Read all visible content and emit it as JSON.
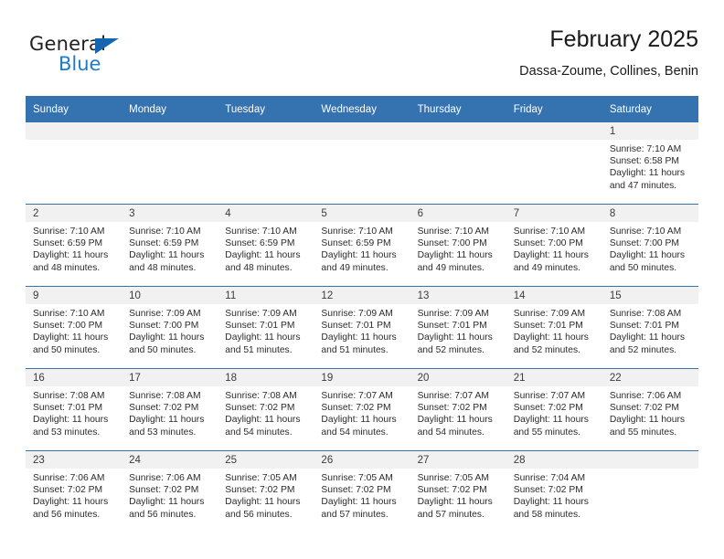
{
  "brand": {
    "name_part1": "General",
    "name_part2": "Blue",
    "triangle_color": "#1565b0",
    "blue_color": "#1f7bc7"
  },
  "header": {
    "title": "February 2025",
    "subtitle": "Dassa-Zoume, Collines, Benin"
  },
  "theme": {
    "header_blue": "#3572b0",
    "daynum_band": "#f1f1f1",
    "cell_background": "#ffffff",
    "text": "#222222"
  },
  "weekday_headers": [
    "Sunday",
    "Monday",
    "Tuesday",
    "Wednesday",
    "Thursday",
    "Friday",
    "Saturday"
  ],
  "weeks": [
    [
      {
        "day": "",
        "sunrise": "",
        "sunset": "",
        "daylight": "",
        "empty": true
      },
      {
        "day": "",
        "sunrise": "",
        "sunset": "",
        "daylight": "",
        "empty": true
      },
      {
        "day": "",
        "sunrise": "",
        "sunset": "",
        "daylight": "",
        "empty": true
      },
      {
        "day": "",
        "sunrise": "",
        "sunset": "",
        "daylight": "",
        "empty": true
      },
      {
        "day": "",
        "sunrise": "",
        "sunset": "",
        "daylight": "",
        "empty": true
      },
      {
        "day": "",
        "sunrise": "",
        "sunset": "",
        "daylight": "",
        "empty": true
      },
      {
        "day": "1",
        "sunrise": "Sunrise: 7:10 AM",
        "sunset": "Sunset: 6:58 PM",
        "daylight": "Daylight: 11 hours and 47 minutes."
      }
    ],
    [
      {
        "day": "2",
        "sunrise": "Sunrise: 7:10 AM",
        "sunset": "Sunset: 6:59 PM",
        "daylight": "Daylight: 11 hours and 48 minutes."
      },
      {
        "day": "3",
        "sunrise": "Sunrise: 7:10 AM",
        "sunset": "Sunset: 6:59 PM",
        "daylight": "Daylight: 11 hours and 48 minutes."
      },
      {
        "day": "4",
        "sunrise": "Sunrise: 7:10 AM",
        "sunset": "Sunset: 6:59 PM",
        "daylight": "Daylight: 11 hours and 48 minutes."
      },
      {
        "day": "5",
        "sunrise": "Sunrise: 7:10 AM",
        "sunset": "Sunset: 6:59 PM",
        "daylight": "Daylight: 11 hours and 49 minutes."
      },
      {
        "day": "6",
        "sunrise": "Sunrise: 7:10 AM",
        "sunset": "Sunset: 7:00 PM",
        "daylight": "Daylight: 11 hours and 49 minutes."
      },
      {
        "day": "7",
        "sunrise": "Sunrise: 7:10 AM",
        "sunset": "Sunset: 7:00 PM",
        "daylight": "Daylight: 11 hours and 49 minutes."
      },
      {
        "day": "8",
        "sunrise": "Sunrise: 7:10 AM",
        "sunset": "Sunset: 7:00 PM",
        "daylight": "Daylight: 11 hours and 50 minutes."
      }
    ],
    [
      {
        "day": "9",
        "sunrise": "Sunrise: 7:10 AM",
        "sunset": "Sunset: 7:00 PM",
        "daylight": "Daylight: 11 hours and 50 minutes."
      },
      {
        "day": "10",
        "sunrise": "Sunrise: 7:09 AM",
        "sunset": "Sunset: 7:00 PM",
        "daylight": "Daylight: 11 hours and 50 minutes."
      },
      {
        "day": "11",
        "sunrise": "Sunrise: 7:09 AM",
        "sunset": "Sunset: 7:01 PM",
        "daylight": "Daylight: 11 hours and 51 minutes."
      },
      {
        "day": "12",
        "sunrise": "Sunrise: 7:09 AM",
        "sunset": "Sunset: 7:01 PM",
        "daylight": "Daylight: 11 hours and 51 minutes."
      },
      {
        "day": "13",
        "sunrise": "Sunrise: 7:09 AM",
        "sunset": "Sunset: 7:01 PM",
        "daylight": "Daylight: 11 hours and 52 minutes."
      },
      {
        "day": "14",
        "sunrise": "Sunrise: 7:09 AM",
        "sunset": "Sunset: 7:01 PM",
        "daylight": "Daylight: 11 hours and 52 minutes."
      },
      {
        "day": "15",
        "sunrise": "Sunrise: 7:08 AM",
        "sunset": "Sunset: 7:01 PM",
        "daylight": "Daylight: 11 hours and 52 minutes."
      }
    ],
    [
      {
        "day": "16",
        "sunrise": "Sunrise: 7:08 AM",
        "sunset": "Sunset: 7:01 PM",
        "daylight": "Daylight: 11 hours and 53 minutes."
      },
      {
        "day": "17",
        "sunrise": "Sunrise: 7:08 AM",
        "sunset": "Sunset: 7:02 PM",
        "daylight": "Daylight: 11 hours and 53 minutes."
      },
      {
        "day": "18",
        "sunrise": "Sunrise: 7:08 AM",
        "sunset": "Sunset: 7:02 PM",
        "daylight": "Daylight: 11 hours and 54 minutes."
      },
      {
        "day": "19",
        "sunrise": "Sunrise: 7:07 AM",
        "sunset": "Sunset: 7:02 PM",
        "daylight": "Daylight: 11 hours and 54 minutes."
      },
      {
        "day": "20",
        "sunrise": "Sunrise: 7:07 AM",
        "sunset": "Sunset: 7:02 PM",
        "daylight": "Daylight: 11 hours and 54 minutes."
      },
      {
        "day": "21",
        "sunrise": "Sunrise: 7:07 AM",
        "sunset": "Sunset: 7:02 PM",
        "daylight": "Daylight: 11 hours and 55 minutes."
      },
      {
        "day": "22",
        "sunrise": "Sunrise: 7:06 AM",
        "sunset": "Sunset: 7:02 PM",
        "daylight": "Daylight: 11 hours and 55 minutes."
      }
    ],
    [
      {
        "day": "23",
        "sunrise": "Sunrise: 7:06 AM",
        "sunset": "Sunset: 7:02 PM",
        "daylight": "Daylight: 11 hours and 56 minutes."
      },
      {
        "day": "24",
        "sunrise": "Sunrise: 7:06 AM",
        "sunset": "Sunset: 7:02 PM",
        "daylight": "Daylight: 11 hours and 56 minutes."
      },
      {
        "day": "25",
        "sunrise": "Sunrise: 7:05 AM",
        "sunset": "Sunset: 7:02 PM",
        "daylight": "Daylight: 11 hours and 56 minutes."
      },
      {
        "day": "26",
        "sunrise": "Sunrise: 7:05 AM",
        "sunset": "Sunset: 7:02 PM",
        "daylight": "Daylight: 11 hours and 57 minutes."
      },
      {
        "day": "27",
        "sunrise": "Sunrise: 7:05 AM",
        "sunset": "Sunset: 7:02 PM",
        "daylight": "Daylight: 11 hours and 57 minutes."
      },
      {
        "day": "28",
        "sunrise": "Sunrise: 7:04 AM",
        "sunset": "Sunset: 7:02 PM",
        "daylight": "Daylight: 11 hours and 58 minutes."
      },
      {
        "day": "",
        "sunrise": "",
        "sunset": "",
        "daylight": "",
        "empty": true
      }
    ]
  ]
}
